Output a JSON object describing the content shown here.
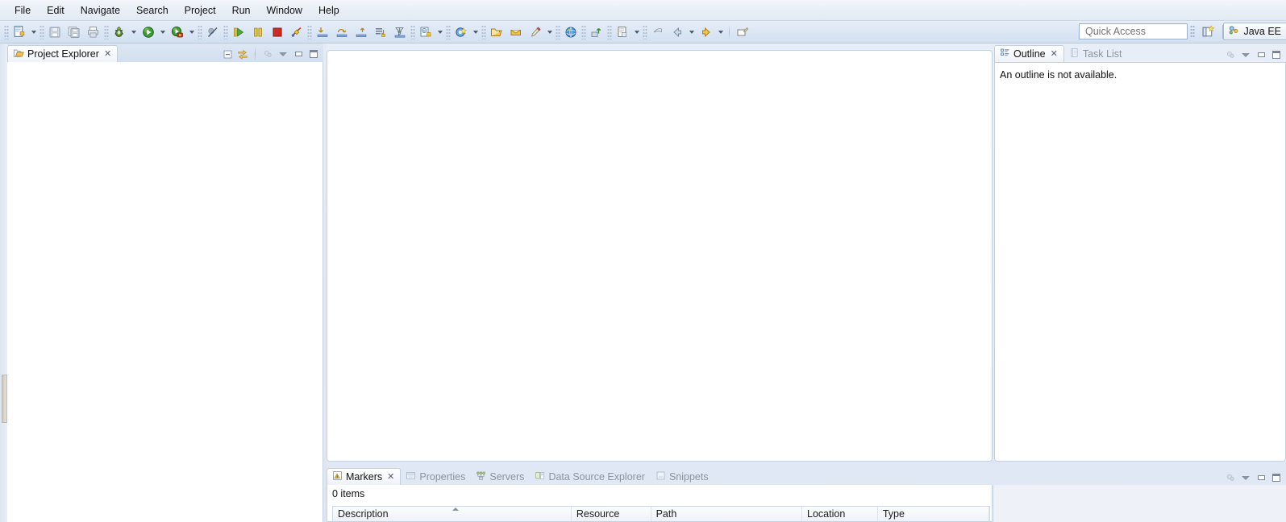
{
  "menu": {
    "items": [
      {
        "label": "File",
        "name": "menu-file"
      },
      {
        "label": "Edit",
        "name": "menu-edit"
      },
      {
        "label": "Navigate",
        "name": "menu-navigate"
      },
      {
        "label": "Search",
        "name": "menu-search"
      },
      {
        "label": "Project",
        "name": "menu-project"
      },
      {
        "label": "Run",
        "name": "menu-run"
      },
      {
        "label": "Window",
        "name": "menu-window"
      },
      {
        "label": "Help",
        "name": "menu-help"
      }
    ]
  },
  "toolbar": {
    "icons": [
      "new-wizard-icon",
      "new-wizard-dropdown",
      "save-icon",
      "save-all-icon",
      "print-icon",
      "debug-icon",
      "debug-dropdown",
      "run-icon",
      "run-dropdown",
      "coverage-icon",
      "coverage-dropdown",
      "skip-breakpoints-icon",
      "resume-icon",
      "suspend-icon",
      "terminate-icon",
      "disconnect-icon",
      "step-into-icon",
      "step-over-icon",
      "step-return-icon",
      "drop-to-frame-icon",
      "use-step-filters-icon",
      "new-java-class-icon",
      "new-java-class-dropdown",
      "new-annotation-icon",
      "new-annotation-dropdown",
      "open-type-icon",
      "open-task-icon",
      "search-icon",
      "search-dropdown",
      "open-web-browser-icon",
      "deploy-icon",
      "new-xml-icon",
      "new-xml-dropdown",
      "previous-annotation-icon",
      "back-icon",
      "back-dropdown",
      "forward-icon",
      "forward-dropdown",
      "last-edit-location-icon"
    ]
  },
  "quick_access": {
    "placeholder": "Quick Access",
    "value": ""
  },
  "perspective": {
    "open_perspective_icon": "open-perspective-icon",
    "active_label": "Java EE",
    "active_icon": "java-ee-perspective-icon"
  },
  "project_explorer": {
    "tab_label": "Project Explorer",
    "tab_icon": "project-explorer-icon",
    "close_glyph": "✕",
    "actions": [
      "collapse-all-icon",
      "link-with-editor-icon",
      "focus-on-active-task-icon",
      "view-menu-icon",
      "minimize-icon",
      "maximize-icon"
    ]
  },
  "editor": {
    "actions": [
      "restore-icon",
      "maximize-icon"
    ],
    "content": ""
  },
  "outline": {
    "tabs": [
      {
        "label": "Outline",
        "icon": "outline-icon",
        "active": true,
        "close_glyph": "✕"
      },
      {
        "label": "Task List",
        "icon": "task-list-icon",
        "active": false,
        "close_glyph": ""
      }
    ],
    "message": "An outline is not available.",
    "actions": [
      "focus-icon",
      "view-menu-icon",
      "minimize-icon",
      "maximize-icon"
    ]
  },
  "bottom_panel": {
    "tabs": [
      {
        "label": "Markers",
        "icon": "markers-icon",
        "active": true,
        "close_glyph": "✕"
      },
      {
        "label": "Properties",
        "icon": "properties-icon",
        "active": false,
        "close_glyph": ""
      },
      {
        "label": "Servers",
        "icon": "servers-icon",
        "active": false,
        "close_glyph": ""
      },
      {
        "label": "Data Source Explorer",
        "icon": "data-source-explorer-icon",
        "active": false,
        "close_glyph": ""
      },
      {
        "label": "Snippets",
        "icon": "snippets-icon",
        "active": false,
        "close_glyph": ""
      }
    ],
    "status": "0 items",
    "columns": [
      "Description",
      "Resource",
      "Path",
      "Location",
      "Type"
    ],
    "rows": [],
    "actions": [
      "filters-icon",
      "view-menu-icon",
      "minimize-icon",
      "maximize-icon"
    ]
  },
  "right_bottom": {
    "actions": [
      "filters-icon",
      "view-menu-icon",
      "minimize-icon",
      "maximize-icon"
    ]
  },
  "colors": {
    "accent": "#3a6ea5",
    "toolbar_bg": "#dbe6f4",
    "panel_bg": "#ffffff",
    "tab_border": "#c3d0e0"
  }
}
